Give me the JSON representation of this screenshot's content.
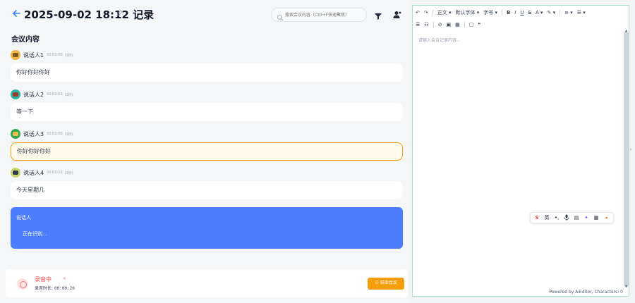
{
  "header": {
    "title": "2025-09-02 18:12 记录",
    "search_placeholder": "搜索会议内容（Ctrl+F快速聚焦）"
  },
  "section_title": "会议内容",
  "transcript": [
    {
      "speaker": "说话人1",
      "time": "00:00:00",
      "duration": "(1秒)",
      "text": "你好你好你好",
      "avatar_color": "#f5b342"
    },
    {
      "speaker": "说话人2",
      "time": "00:00:03",
      "duration": "(1秒)",
      "text": "等一下",
      "avatar_color": "#2bb3a3"
    },
    {
      "speaker": "说话人3",
      "time": "00:00:00",
      "duration": "(1秒)",
      "text": "你好你好你好",
      "avatar_color": "#34a853"
    },
    {
      "speaker": "说话人4",
      "time": "00:00:16",
      "duration": "(1秒)",
      "text": "今天星期几",
      "avatar_color": "#c9d66b"
    }
  ],
  "live": {
    "speaker": "说话人",
    "text": "正在识别..."
  },
  "footer": {
    "status": "录音中",
    "close": "×",
    "duration_label": "录音时长:",
    "duration_value": "00:00:20",
    "end_button": "结束会议"
  },
  "editor": {
    "toolbar_row1": [
      "↶",
      "↷",
      "正文 ▾",
      "默认字体 ▾",
      "字号 ▾",
      "B",
      "I",
      "U",
      "S",
      "A ▾",
      "✎ ▾",
      "≡ ▾",
      "☰ ▾"
    ],
    "toolbar_row2": [
      "☰",
      "☷",
      "⊘",
      "▣",
      "▦",
      "▢",
      "❝"
    ],
    "placeholder": "请输入会议记录内容...",
    "powered_by": "Powered by AiEditor, Characters: 0"
  },
  "colors": {
    "accent": "#3b82f6",
    "live_bg": "#4d7dff",
    "end_button": "#f59e0b",
    "recording": "#ef4444"
  }
}
